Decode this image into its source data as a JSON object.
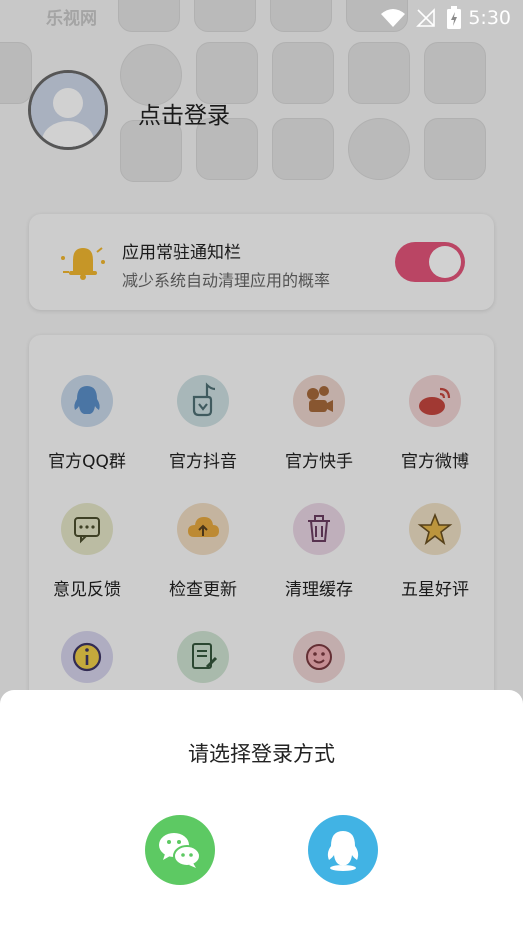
{
  "status_bar": {
    "time": "5:30"
  },
  "header": {
    "login_text": "点击登录"
  },
  "notification_card": {
    "title": "应用常驻通知栏",
    "subtitle": "减少系统自动清理应用的概率",
    "toggle_on": true,
    "toggle_color": "#e3557a"
  },
  "grid": {
    "items": [
      {
        "label": "官方QQ群",
        "icon": "qq-icon",
        "bg": "#c8d8ea"
      },
      {
        "label": "官方抖音",
        "icon": "douyin-icon",
        "bg": "#cde0e2"
      },
      {
        "label": "官方快手",
        "icon": "kuaishou-icon",
        "bg": "#ecd5cd"
      },
      {
        "label": "官方微博",
        "icon": "weibo-icon",
        "bg": "#efd3d3"
      },
      {
        "label": "意见反馈",
        "icon": "feedback-icon",
        "bg": "#e5e6c7"
      },
      {
        "label": "检查更新",
        "icon": "update-icon",
        "bg": "#efdcc2"
      },
      {
        "label": "清理缓存",
        "icon": "trash-icon",
        "bg": "#ead6e5"
      },
      {
        "label": "五星好评",
        "icon": "star-icon",
        "bg": "#eee0c5"
      },
      {
        "label": "",
        "icon": "info-icon",
        "bg": "#d6d4ec"
      },
      {
        "label": "",
        "icon": "notepad-icon",
        "bg": "#cfe3d2"
      },
      {
        "label": "",
        "icon": "smile-icon",
        "bg": "#edd3d3"
      }
    ]
  },
  "login_sheet": {
    "title": "请选择登录方式",
    "options": [
      {
        "name": "wechat",
        "icon": "wechat-icon",
        "color": "#5dc963"
      },
      {
        "name": "qq",
        "icon": "qq-icon",
        "color": "#41b3e4"
      }
    ]
  }
}
